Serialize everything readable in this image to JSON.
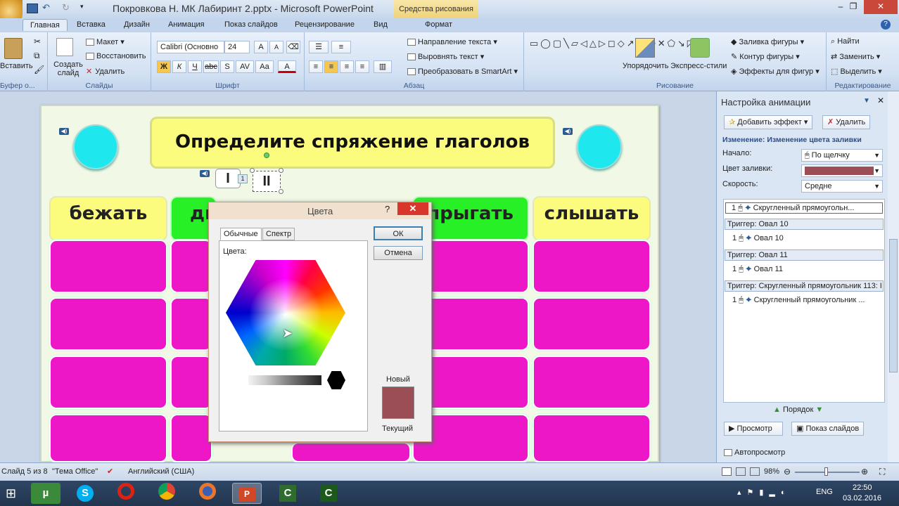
{
  "window": {
    "title": "Покровкова Н. МК Лабиринт 2.pptx - Microsoft PowerPoint",
    "context_tab": "Средства рисования"
  },
  "tabs": [
    "Главная",
    "Вставка",
    "Дизайн",
    "Анимация",
    "Показ слайдов",
    "Рецензирование",
    "Вид",
    "Формат"
  ],
  "ribbon": {
    "clipboard": {
      "paste": "Вставить",
      "label": "Буфер о..."
    },
    "slides": {
      "new_slide": "Создать слайд",
      "layout": "Макет",
      "reset": "Восстановить",
      "delete": "Удалить",
      "label": "Слайды"
    },
    "font": {
      "name": "Calibri (Основно",
      "size": "24",
      "label": "Шрифт"
    },
    "paragraph": {
      "direction": "Направление текста",
      "align": "Выровнять текст",
      "smartart": "Преобразовать в SmartArt",
      "label": "Абзац"
    },
    "drawing": {
      "arrange": "Упорядочить",
      "quick_styles": "Экспресс-стили",
      "fill": "Заливка фигуры",
      "outline": "Контур фигуры",
      "effects": "Эффекты для фигур",
      "label": "Рисование"
    },
    "editing": {
      "find": "Найти",
      "replace": "Заменить",
      "select": "Выделить",
      "label": "Редактирование"
    }
  },
  "slide": {
    "title": "Определите спряжение глаголов",
    "marker1": "I",
    "marker2": "II",
    "marker_num": "1",
    "headers": [
      "бежать",
      "ды",
      "прыгать",
      "слышать"
    ],
    "colors": {
      "magenta": "#ee17c8",
      "yellow": "#fbfb7e",
      "green": "#27f027",
      "cyan": "#1ee8ee"
    }
  },
  "dialog": {
    "title": "Цвета",
    "help": "?",
    "tab_standard": "Обычные",
    "tab_custom": "Спектр",
    "colors_label": "Цвета:",
    "ok": "ОК",
    "cancel": "Отмена",
    "new_label": "Новый",
    "current_label": "Текущий",
    "selected_color": "#9b4e55"
  },
  "panel": {
    "title": "Настройка анимации",
    "add_effect": "Добавить эффект",
    "delete": "Удалить",
    "change_label": "Изменение: Изменение цвета заливки",
    "start_label": "Начало:",
    "start_value": "По щелчку",
    "fill_label": "Цвет заливки:",
    "speed_label": "Скорость:",
    "speed_value": "Средне",
    "items": [
      {
        "num": "1",
        "text": "Скругленный прямоугольн..."
      },
      {
        "trigger": "Триггер: Овал 10",
        "num": "1",
        "text": "Овал 10"
      },
      {
        "trigger": "Триггер: Овал 11",
        "num": "1",
        "text": "Овал 11"
      },
      {
        "trigger": "Триггер: Скругленный прямоугольник 113: I",
        "num": "1",
        "text": "Скругленный прямоугольник ..."
      }
    ],
    "order": "Порядок",
    "preview": "Просмотр",
    "slideshow": "Показ слайдов",
    "autopreview": "Автопросмотр"
  },
  "status": {
    "slide": "Слайд 5 из 8",
    "theme": "\"Тема Office\"",
    "lang": "Английский (США)",
    "zoom": "98%"
  },
  "tray": {
    "lang": "ENG",
    "time": "22:50",
    "date": "03.02.2016"
  }
}
